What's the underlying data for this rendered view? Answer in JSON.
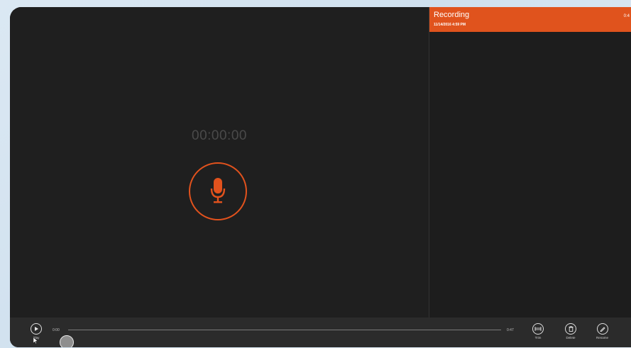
{
  "recorder": {
    "timer": "00:00:00"
  },
  "recordings": [
    {
      "title": "Recording",
      "date": "11/14/2016 4:59 PM",
      "duration_partial": "0:4"
    }
  ],
  "playback": {
    "current_time": "0:00",
    "total_time": "0:47",
    "position_fraction": 0.0
  },
  "appbar": {
    "play_label": "Play",
    "trim_label": "Trim",
    "delete_label": "Delete",
    "rename_label": "Rename"
  },
  "colors": {
    "accent": "#e0531d",
    "background": "#1f1f1f",
    "appbar": "#2b2b2b"
  },
  "icons": [
    "microphone-icon",
    "play-icon",
    "trim-icon",
    "delete-icon",
    "rename-icon"
  ]
}
